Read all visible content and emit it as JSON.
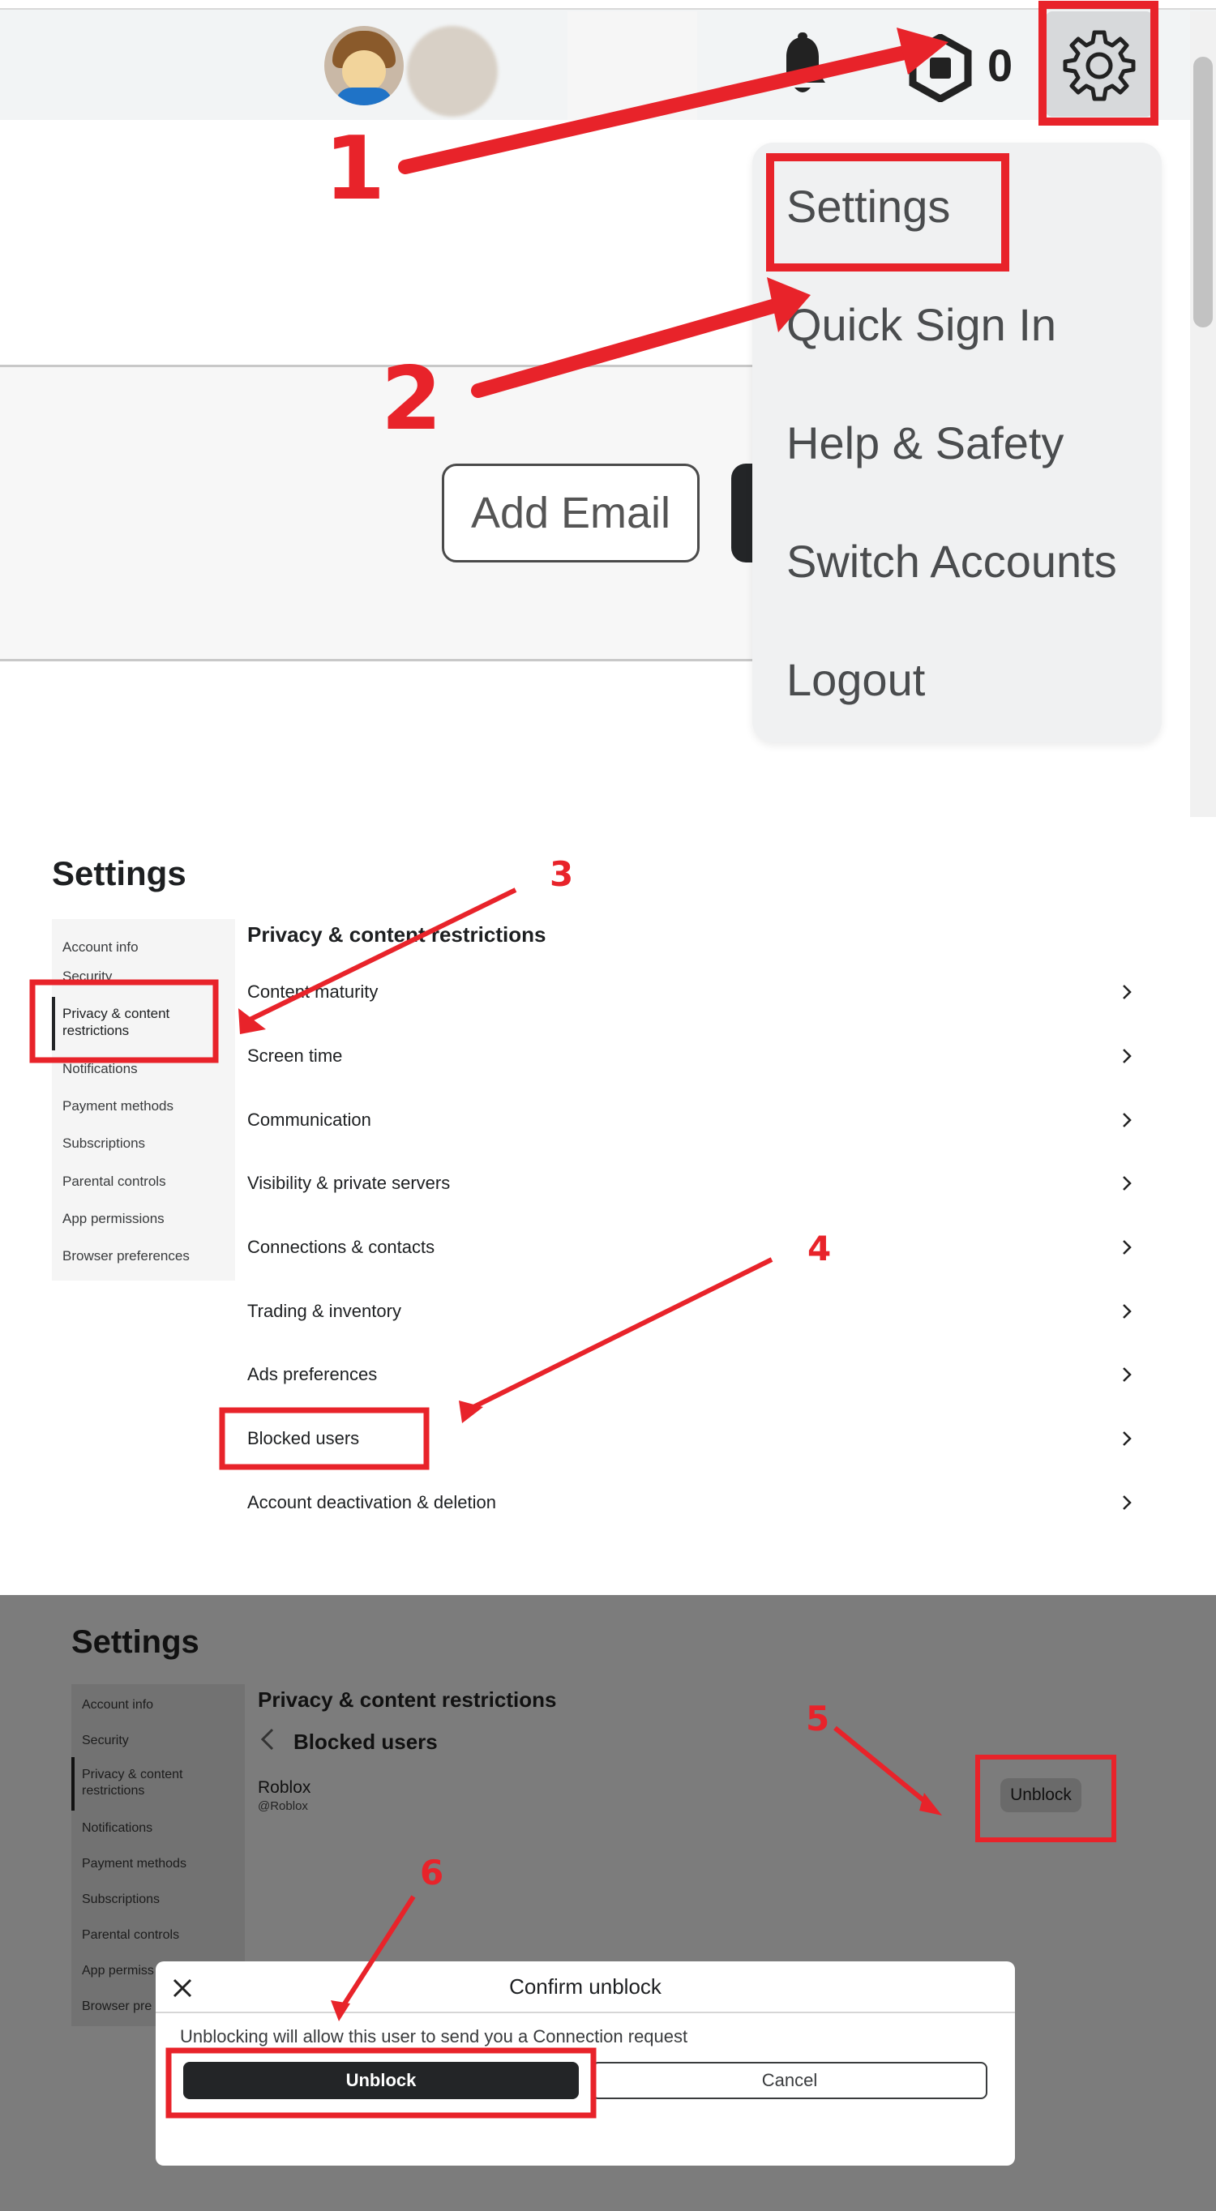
{
  "header": {
    "robux_count": "0",
    "icons": [
      "avatar",
      "bell-icon",
      "robux-icon",
      "gear-icon"
    ]
  },
  "dropdown": {
    "items": [
      "Settings",
      "Quick Sign In",
      "Help & Safety",
      "Switch Accounts",
      "Logout"
    ]
  },
  "account": {
    "add_email_label": "Add Email"
  },
  "settings_page": {
    "title": "Settings",
    "sidebar": [
      "Account info",
      "Security",
      "Privacy & content restrictions",
      "Notifications",
      "Payment methods",
      "Subscriptions",
      "Parental controls",
      "App permissions",
      "Browser preferences"
    ],
    "sidebar_active": "Privacy & content restrictions",
    "heading": "Privacy & content restrictions",
    "rows": [
      "Content maturity",
      "Screen time",
      "Communication",
      "Visibility & private servers",
      "Connections & contacts",
      "Trading & inventory",
      "Ads preferences",
      "Blocked users",
      "Account deactivation & deletion"
    ]
  },
  "blocked_page": {
    "title": "Settings",
    "sidebar": [
      "Account info",
      "Security",
      "Privacy & content restrictions",
      "Notifications",
      "Payment methods",
      "Subscriptions",
      "Parental controls",
      "App permiss",
      "Browser pre"
    ],
    "heading": "Privacy & content restrictions",
    "subheading": "Blocked users",
    "user_name": "Roblox",
    "user_handle": "@Roblox",
    "unblock_label": "Unblock"
  },
  "modal": {
    "title": "Confirm unblock",
    "message": "Unblocking will allow this user to send you a Connection request",
    "confirm_label": "Unblock",
    "cancel_label": "Cancel"
  },
  "annotations": {
    "numbers": [
      "1",
      "2",
      "3",
      "4",
      "5",
      "6"
    ],
    "color": "#e8232a"
  },
  "colors": {
    "annotation_red": "#e8232a",
    "dark_button": "#232527",
    "overlay_gray": "#7c7c7c"
  }
}
